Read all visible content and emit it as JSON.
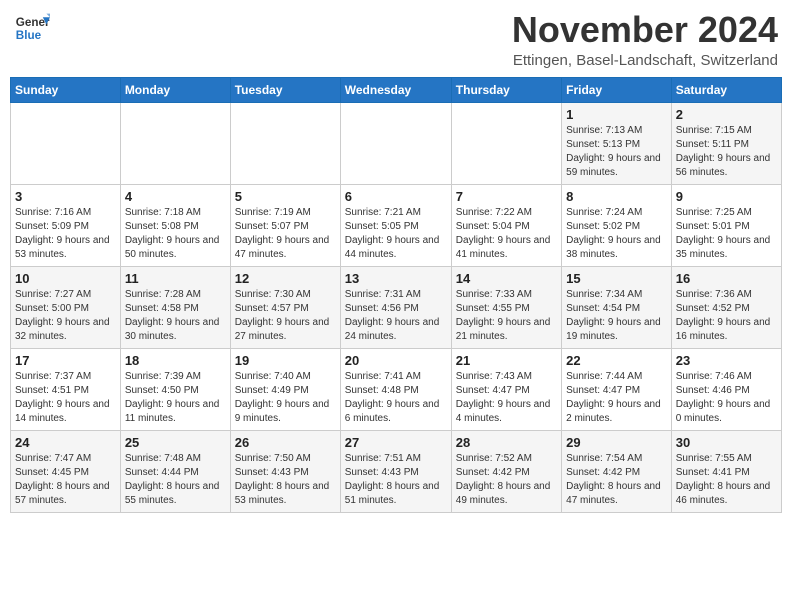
{
  "logo": {
    "line1": "General",
    "line2": "Blue"
  },
  "title": "November 2024",
  "subtitle": "Ettingen, Basel-Landschaft, Switzerland",
  "weekdays": [
    "Sunday",
    "Monday",
    "Tuesday",
    "Wednesday",
    "Thursday",
    "Friday",
    "Saturday"
  ],
  "weeks": [
    [
      {
        "day": "",
        "info": ""
      },
      {
        "day": "",
        "info": ""
      },
      {
        "day": "",
        "info": ""
      },
      {
        "day": "",
        "info": ""
      },
      {
        "day": "",
        "info": ""
      },
      {
        "day": "1",
        "info": "Sunrise: 7:13 AM\nSunset: 5:13 PM\nDaylight: 9 hours and 59 minutes."
      },
      {
        "day": "2",
        "info": "Sunrise: 7:15 AM\nSunset: 5:11 PM\nDaylight: 9 hours and 56 minutes."
      }
    ],
    [
      {
        "day": "3",
        "info": "Sunrise: 7:16 AM\nSunset: 5:09 PM\nDaylight: 9 hours and 53 minutes."
      },
      {
        "day": "4",
        "info": "Sunrise: 7:18 AM\nSunset: 5:08 PM\nDaylight: 9 hours and 50 minutes."
      },
      {
        "day": "5",
        "info": "Sunrise: 7:19 AM\nSunset: 5:07 PM\nDaylight: 9 hours and 47 minutes."
      },
      {
        "day": "6",
        "info": "Sunrise: 7:21 AM\nSunset: 5:05 PM\nDaylight: 9 hours and 44 minutes."
      },
      {
        "day": "7",
        "info": "Sunrise: 7:22 AM\nSunset: 5:04 PM\nDaylight: 9 hours and 41 minutes."
      },
      {
        "day": "8",
        "info": "Sunrise: 7:24 AM\nSunset: 5:02 PM\nDaylight: 9 hours and 38 minutes."
      },
      {
        "day": "9",
        "info": "Sunrise: 7:25 AM\nSunset: 5:01 PM\nDaylight: 9 hours and 35 minutes."
      }
    ],
    [
      {
        "day": "10",
        "info": "Sunrise: 7:27 AM\nSunset: 5:00 PM\nDaylight: 9 hours and 32 minutes."
      },
      {
        "day": "11",
        "info": "Sunrise: 7:28 AM\nSunset: 4:58 PM\nDaylight: 9 hours and 30 minutes."
      },
      {
        "day": "12",
        "info": "Sunrise: 7:30 AM\nSunset: 4:57 PM\nDaylight: 9 hours and 27 minutes."
      },
      {
        "day": "13",
        "info": "Sunrise: 7:31 AM\nSunset: 4:56 PM\nDaylight: 9 hours and 24 minutes."
      },
      {
        "day": "14",
        "info": "Sunrise: 7:33 AM\nSunset: 4:55 PM\nDaylight: 9 hours and 21 minutes."
      },
      {
        "day": "15",
        "info": "Sunrise: 7:34 AM\nSunset: 4:54 PM\nDaylight: 9 hours and 19 minutes."
      },
      {
        "day": "16",
        "info": "Sunrise: 7:36 AM\nSunset: 4:52 PM\nDaylight: 9 hours and 16 minutes."
      }
    ],
    [
      {
        "day": "17",
        "info": "Sunrise: 7:37 AM\nSunset: 4:51 PM\nDaylight: 9 hours and 14 minutes."
      },
      {
        "day": "18",
        "info": "Sunrise: 7:39 AM\nSunset: 4:50 PM\nDaylight: 9 hours and 11 minutes."
      },
      {
        "day": "19",
        "info": "Sunrise: 7:40 AM\nSunset: 4:49 PM\nDaylight: 9 hours and 9 minutes."
      },
      {
        "day": "20",
        "info": "Sunrise: 7:41 AM\nSunset: 4:48 PM\nDaylight: 9 hours and 6 minutes."
      },
      {
        "day": "21",
        "info": "Sunrise: 7:43 AM\nSunset: 4:47 PM\nDaylight: 9 hours and 4 minutes."
      },
      {
        "day": "22",
        "info": "Sunrise: 7:44 AM\nSunset: 4:47 PM\nDaylight: 9 hours and 2 minutes."
      },
      {
        "day": "23",
        "info": "Sunrise: 7:46 AM\nSunset: 4:46 PM\nDaylight: 9 hours and 0 minutes."
      }
    ],
    [
      {
        "day": "24",
        "info": "Sunrise: 7:47 AM\nSunset: 4:45 PM\nDaylight: 8 hours and 57 minutes."
      },
      {
        "day": "25",
        "info": "Sunrise: 7:48 AM\nSunset: 4:44 PM\nDaylight: 8 hours and 55 minutes."
      },
      {
        "day": "26",
        "info": "Sunrise: 7:50 AM\nSunset: 4:43 PM\nDaylight: 8 hours and 53 minutes."
      },
      {
        "day": "27",
        "info": "Sunrise: 7:51 AM\nSunset: 4:43 PM\nDaylight: 8 hours and 51 minutes."
      },
      {
        "day": "28",
        "info": "Sunrise: 7:52 AM\nSunset: 4:42 PM\nDaylight: 8 hours and 49 minutes."
      },
      {
        "day": "29",
        "info": "Sunrise: 7:54 AM\nSunset: 4:42 PM\nDaylight: 8 hours and 47 minutes."
      },
      {
        "day": "30",
        "info": "Sunrise: 7:55 AM\nSunset: 4:41 PM\nDaylight: 8 hours and 46 minutes."
      }
    ]
  ]
}
